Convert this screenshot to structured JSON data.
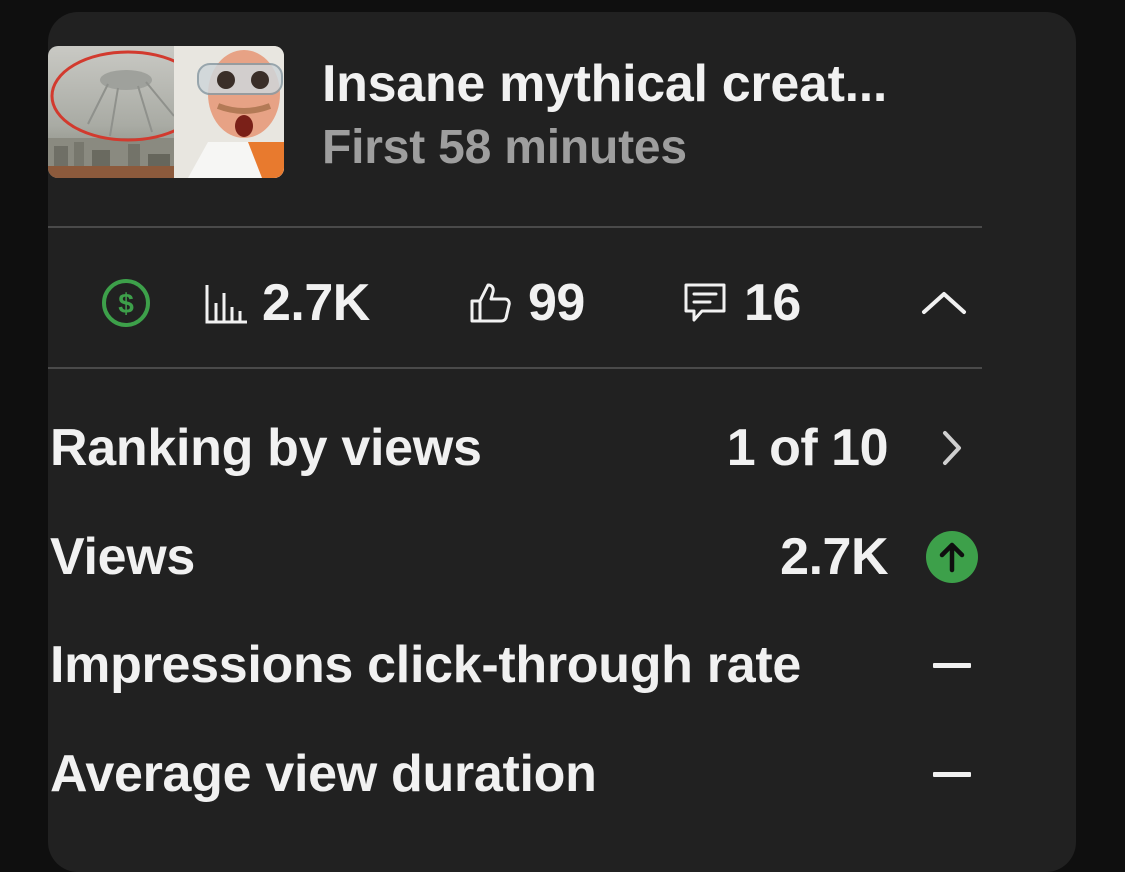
{
  "video": {
    "title": "Insane mythical creat...",
    "subtitle": "First 58 minutes"
  },
  "stats": {
    "views": "2.7K",
    "likes": "99",
    "comments": "16"
  },
  "metrics": [
    {
      "label": "Ranking by views",
      "value": "1 of 10",
      "end": "chevron-right"
    },
    {
      "label": "Views",
      "value": "2.7K",
      "end": "trend-up"
    },
    {
      "label": "Impressions click-through rate",
      "value": "",
      "end": "dash"
    },
    {
      "label": "Average view duration",
      "value": "",
      "end": "dash"
    }
  ],
  "colors": {
    "background": "#0f0f0f",
    "card": "#212121",
    "text": "#f1f1f1",
    "muted": "#9e9e9e",
    "accent_green": "#3da04a"
  }
}
